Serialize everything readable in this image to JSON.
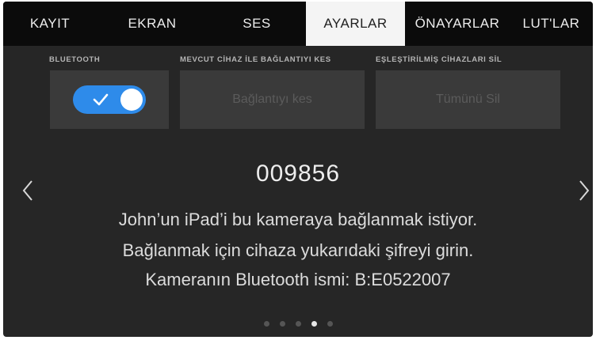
{
  "tabs": [
    {
      "label": "KAYIT",
      "active": false
    },
    {
      "label": "EKRAN",
      "active": false
    },
    {
      "label": "SES",
      "active": false
    },
    {
      "label": "AYARLAR",
      "active": true
    },
    {
      "label": "ÖNAYARLAR",
      "active": false
    },
    {
      "label": "LUT'LAR",
      "active": false
    }
  ],
  "bluetooth": {
    "label": "BLUETOOTH",
    "enabled": true
  },
  "disconnect": {
    "label": "MEVCUT CİHAZ İLE BAĞLANTIYI KES",
    "button": "Bağlantıyı kes"
  },
  "forget": {
    "label": "EŞLEŞTİRİLMİŞ CİHAZLARI SİL",
    "button": "Tümünü Sil"
  },
  "pairing": {
    "code": "009856",
    "line1": "John’un iPad’i bu kameraya bağlanmak istiyor.",
    "line2": "Bağlanmak için cihaza yukarıdaki şifreyi girin.",
    "line3": "Kameranın Bluetooth ismi: B:E0522007"
  },
  "pages": {
    "count": 5,
    "current": 4
  },
  "colors": {
    "toggle_on": "#2e8bea",
    "active_tab_bg": "#f4f4f4"
  }
}
